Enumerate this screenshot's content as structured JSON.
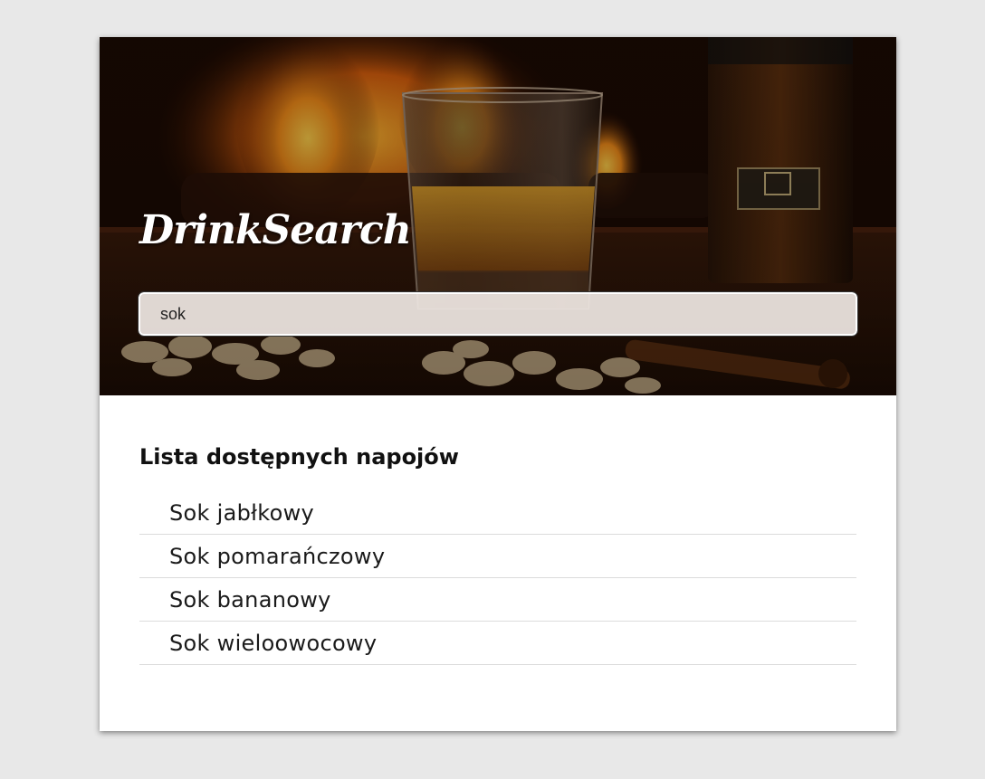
{
  "app": {
    "logo_text": "DrinkSearch"
  },
  "search": {
    "value": "sok",
    "placeholder": ""
  },
  "results": {
    "heading": "Lista dostępnych napojów",
    "items": [
      "Sok jabłkowy",
      "Sok pomarańczowy",
      "Sok bananowy",
      "Sok wieloowocowy"
    ]
  },
  "hero_image": {
    "description_icon": "whisky-glass-fireplace-image"
  },
  "colors": {
    "page_background": "#e8e8e8",
    "card_background": "#ffffff",
    "divider": "#dcdcdc"
  }
}
